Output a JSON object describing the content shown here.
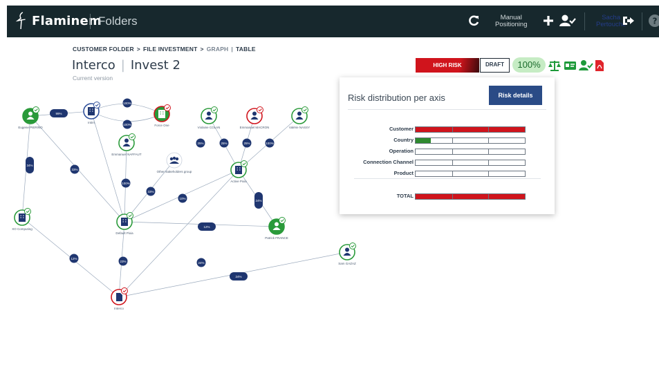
{
  "topbar": {
    "brand": "Flaminem",
    "section": "Folders",
    "manual_line1": "Manual",
    "manual_line2": "Positioning",
    "user_first": "Sacha",
    "user_last": "Pertouche",
    "icons": [
      "refresh-icon",
      "plus-icon",
      "user-check-icon",
      "logout-icon",
      "help-icon"
    ]
  },
  "breadcrumb": {
    "customer_folder": "CUSTOMER FOLDER",
    "sep1": ">",
    "file_investment": "FILE INVESTMENT",
    "sep2": ">",
    "graph": "GRAPH",
    "sep3": "|",
    "table": "TABLE"
  },
  "header": {
    "entity": "Interco",
    "invest": "Invest 2",
    "subtitle": "Current version"
  },
  "risk_header": {
    "risk_label": "HIGH RISK",
    "draft_label": "DRAFT",
    "percent": "100%",
    "risk_color": "#d0141c",
    "icons": [
      "scale-icon",
      "id-card-icon",
      "user-check-icon",
      "pdf-icon"
    ]
  },
  "graph": {
    "nodes": [
      {
        "id": "n1",
        "label": "Eugene PIERINO",
        "kind": "person",
        "ring": "green",
        "fill": "green"
      },
      {
        "id": "n2",
        "label": "Intim",
        "kind": "company",
        "ring": "blue",
        "fill": "white"
      },
      {
        "id": "n3",
        "label": "Force One",
        "kind": "company",
        "ring": "red",
        "fill": "green"
      },
      {
        "id": "n4",
        "label": "Violaine COLAN",
        "kind": "person",
        "ring": "green",
        "fill": "white"
      },
      {
        "id": "n5",
        "label": "Emmanuel MACRON",
        "kind": "person",
        "ring": "red",
        "fill": "white"
      },
      {
        "id": "n6",
        "label": "Valérie NASSY",
        "kind": "person",
        "ring": "green",
        "fill": "white"
      },
      {
        "id": "n7",
        "label": "Emmanuel NAFFAUT",
        "kind": "person",
        "ring": "green",
        "fill": "white"
      },
      {
        "id": "n8",
        "label": "Other stakeholders group",
        "kind": "group",
        "ring": "none",
        "fill": "white"
      },
      {
        "id": "n9",
        "label": "Active Pixia",
        "kind": "company",
        "ring": "green",
        "fill": "white"
      },
      {
        "id": "n10",
        "label": "XO Computing",
        "kind": "company",
        "ring": "green",
        "fill": "white"
      },
      {
        "id": "n11",
        "label": "Default Pixia",
        "kind": "company",
        "ring": "green",
        "fill": "white"
      },
      {
        "id": "n12",
        "label": "Patrick FRANCE",
        "kind": "person",
        "ring": "green",
        "fill": "green"
      },
      {
        "id": "n13",
        "label": "Sam GAZAZ",
        "kind": "person",
        "ring": "green",
        "fill": "white"
      },
      {
        "id": "n14",
        "label": "Interco",
        "kind": "folder",
        "ring": "red",
        "fill": "white"
      }
    ],
    "edge_labels": [
      "99%",
      "100%",
      "100%",
      "100%",
      "25%",
      "25%",
      "25%",
      "100%",
      "100%",
      "34%",
      "33%",
      "33%",
      "10%",
      "24%",
      "12%",
      "12%",
      "23%",
      "24%",
      "24%",
      "0%"
    ]
  },
  "risk_panel": {
    "title": "Risk distribution per axis",
    "button": "Risk details",
    "axes": [
      {
        "label": "Customer",
        "level": 1.0,
        "color": "#d0141c"
      },
      {
        "label": "Country",
        "level": 0.14,
        "color": "#2f8a2f"
      },
      {
        "label": "Operation",
        "level": 0.0,
        "color": "#ffffff"
      },
      {
        "label": "Connection Channel",
        "level": 0.0,
        "color": "#ffffff"
      },
      {
        "label": "Product",
        "level": 0.0,
        "color": "#ffffff"
      }
    ],
    "total": {
      "label": "TOTAL",
      "level": 1.0,
      "color": "#d0141c"
    }
  }
}
